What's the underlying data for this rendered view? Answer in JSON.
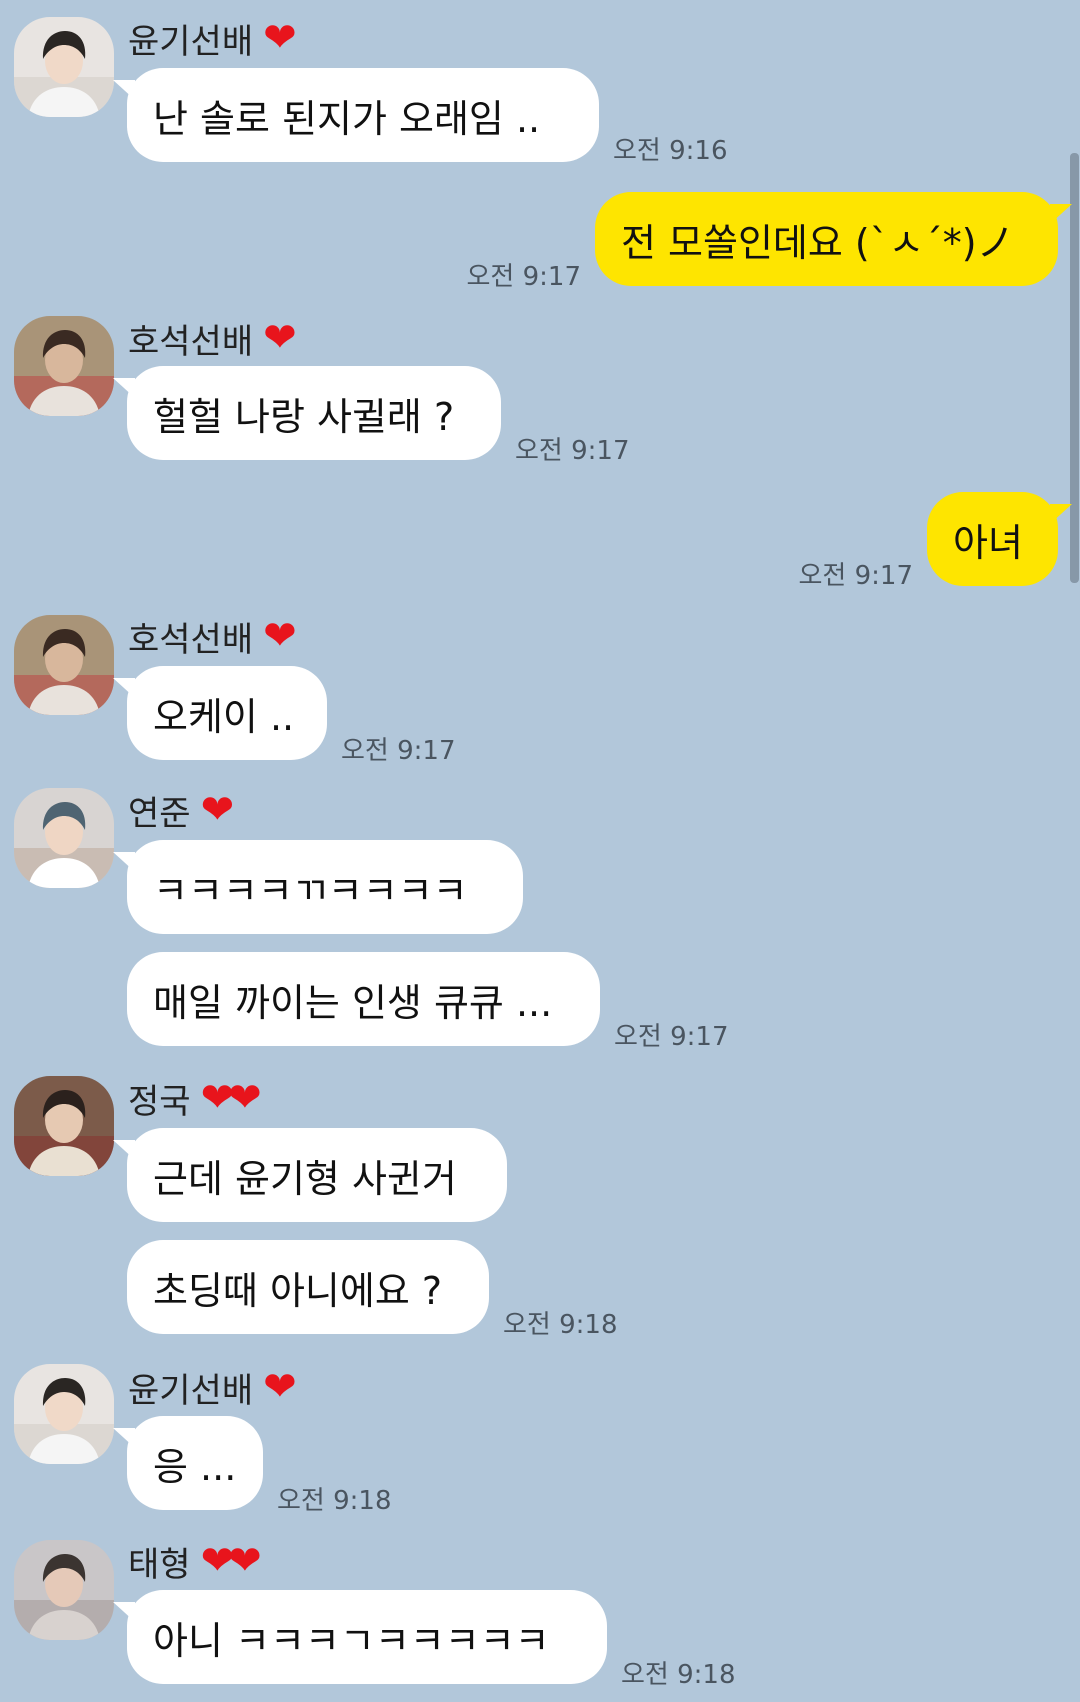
{
  "messages": [
    {
      "kind": "in",
      "sender": "윤기선배",
      "hearts": "❤",
      "avatar": "yoongi",
      "bubbles": [
        "난 솔로 된지가 오래임 .."
      ],
      "time": "오전 9:16"
    },
    {
      "kind": "out",
      "bubbles": [
        "전 모쏠인데요 (`ㅅ´*)ノ"
      ],
      "time": "오전 9:17"
    },
    {
      "kind": "in",
      "sender": "호석선배",
      "hearts": "❤",
      "avatar": "hoseok",
      "bubbles": [
        "헐헐 나랑 사귈래 ?"
      ],
      "time": "오전 9:17"
    },
    {
      "kind": "out",
      "bubbles": [
        "아녀"
      ],
      "time": "오전 9:17"
    },
    {
      "kind": "in",
      "sender": "호석선배",
      "hearts": "❤",
      "avatar": "hoseok",
      "bubbles": [
        "오케이 .."
      ],
      "time": "오전 9:17"
    },
    {
      "kind": "in",
      "sender": "연준",
      "hearts": "❤",
      "avatar": "yeonjun",
      "bubbles": [
        "ㅋㅋㅋㅋㄲㅋㅋㅋㅋ",
        "매일 까이는 인생 큐큐 ..."
      ],
      "time": "오전 9:17"
    },
    {
      "kind": "in",
      "sender": "정국",
      "hearts": "❤❤",
      "avatar": "jungkook",
      "bubbles": [
        "근데 윤기형 사귄거",
        "초딩때 아니에요 ?"
      ],
      "time": "오전 9:18"
    },
    {
      "kind": "in",
      "sender": "윤기선배",
      "hearts": "❤",
      "avatar": "yoongi",
      "bubbles": [
        "응 ..."
      ],
      "time": "오전 9:18"
    },
    {
      "kind": "in",
      "sender": "태형",
      "hearts": "❤❤",
      "avatar": "taehyung",
      "bubbles": [
        "아니 ㅋㅋㅋㄱㅋㅋㅋㅋㅋ"
      ],
      "time": "오전 9:18"
    }
  ],
  "colors": {
    "background": "#b2c7da",
    "incoming_bubble": "#ffffff",
    "outgoing_bubble": "#fee500",
    "heart": "#e8141c"
  }
}
